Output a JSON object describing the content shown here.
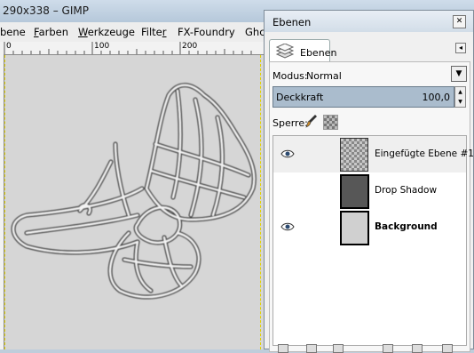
{
  "window": {
    "title": "290x338 – GIMP"
  },
  "menubar": [
    {
      "id": "bene",
      "label": "bene",
      "u": ""
    },
    {
      "id": "farben",
      "label": "arben",
      "u": "F"
    },
    {
      "id": "werkzeuge",
      "label": "erkzeuge",
      "u": "W"
    },
    {
      "id": "filter",
      "label": "Filte",
      "u": "r"
    },
    {
      "id": "fxfoundry",
      "label": "FX-Foundry",
      "u": ""
    },
    {
      "id": "ghc",
      "label": "Ghc",
      "u": ""
    }
  ],
  "ruler": {
    "ticks": [
      "0",
      "100",
      "200"
    ]
  },
  "dock": {
    "title": "Ebenen",
    "tab_label": "Ebenen",
    "modus_label": "Modus:",
    "modus_value": "Normal",
    "opacity_label": "Deckkraft",
    "opacity_value": "100,0",
    "lock_label": "Sperre:",
    "layers": [
      {
        "name": "Eingefügte Ebene #1",
        "visible": true,
        "bold": false
      },
      {
        "name": "Drop Shadow",
        "visible": false,
        "bold": false
      },
      {
        "name": "Background",
        "visible": true,
        "bold": true
      }
    ]
  },
  "colors": {
    "guide": "#e2d200",
    "opacity_bar": "#aabccd",
    "titlebar": "#c3d3e3"
  }
}
